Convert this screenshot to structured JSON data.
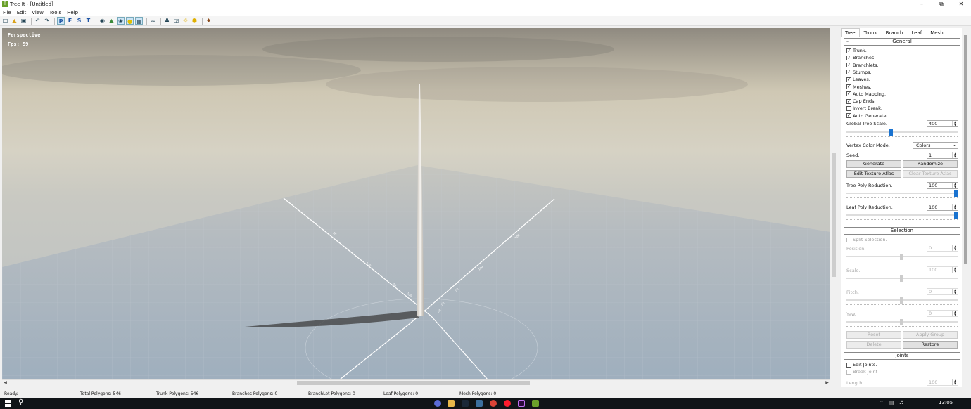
{
  "window": {
    "title": "Tree It - [Untitled]",
    "app_icon": "tree-it-logo"
  },
  "menu": [
    "File",
    "Edit",
    "View",
    "Tools",
    "Help"
  ],
  "toolbar": {
    "letters": [
      "P",
      "F",
      "S",
      "T"
    ]
  },
  "viewport": {
    "mode": "Perspective",
    "fps": "Fps: 59",
    "axis_labels": [
      "100",
      "50",
      "100",
      "50",
      "100",
      "50",
      "100",
      "50",
      "50"
    ]
  },
  "panel": {
    "tabs": [
      "Tree",
      "Trunk",
      "Branch",
      "Leaf",
      "Mesh"
    ],
    "active_tab": "Tree",
    "general": {
      "title": "General",
      "checks": [
        {
          "label": "Trunk.",
          "checked": true
        },
        {
          "label": "Branches.",
          "checked": true
        },
        {
          "label": "Branchlets.",
          "checked": true
        },
        {
          "label": "Stumps.",
          "checked": true
        },
        {
          "label": "Leaves.",
          "checked": true
        },
        {
          "label": "Meshes.",
          "checked": true
        },
        {
          "label": "Auto Mapping.",
          "checked": true
        },
        {
          "label": "Cap Ends.",
          "checked": true
        },
        {
          "label": "Invert Break.",
          "checked": false
        },
        {
          "label": "Auto Generate.",
          "checked": true
        }
      ],
      "global_scale_label": "Global Tree Scale.",
      "global_scale_value": "400",
      "global_scale_level": 0.4,
      "vertex_color_label": "Vertex Color Mode.",
      "vertex_color_value": "Colors",
      "seed_label": "Seed.",
      "seed_value": "1",
      "generate": "Generate",
      "randomize": "Randomize",
      "edit_atlas": "Edit Texture Atlas",
      "clear_atlas": "Clear Texture Atlas",
      "tree_poly_label": "Tree Poly Reduction.",
      "tree_poly_value": "100",
      "tree_poly_level": 1.0,
      "leaf_poly_label": "Leaf Poly Reduction.",
      "leaf_poly_value": "100",
      "leaf_poly_level": 1.0
    },
    "selection": {
      "title": "Selection",
      "split_label": "Split Selection.",
      "position_label": "Position.",
      "position_value": "0",
      "scale_label": "Scale.",
      "scale_value": "100",
      "pitch_label": "Pitch.",
      "pitch_value": "0",
      "yaw_label": "Yaw.",
      "yaw_value": "0",
      "reset": "Reset",
      "apply_group": "Apply Group",
      "delete": "Delete",
      "restore": "Restore"
    },
    "joints": {
      "title": "Joints",
      "edit_label": "Edit Joints.",
      "break_label": "Break Joint",
      "length_label": "Length.",
      "length_value": "100"
    }
  },
  "status": {
    "ready": "Ready.",
    "total": "Total Polygons: 546",
    "trunk": "Trunk Polygons: 546",
    "branches": "Branches Polygons: 0",
    "branchlet": "BranchLet Polygons: 0",
    "leaf": "Leaf Polygons: 0",
    "mesh": "Mesh Polygons: 0"
  },
  "taskbar": {
    "time": "13:05"
  },
  "colors": {
    "accent": "#1a73d0",
    "sky_top": "#c8c3b2",
    "ground": "#aeb9c3"
  }
}
